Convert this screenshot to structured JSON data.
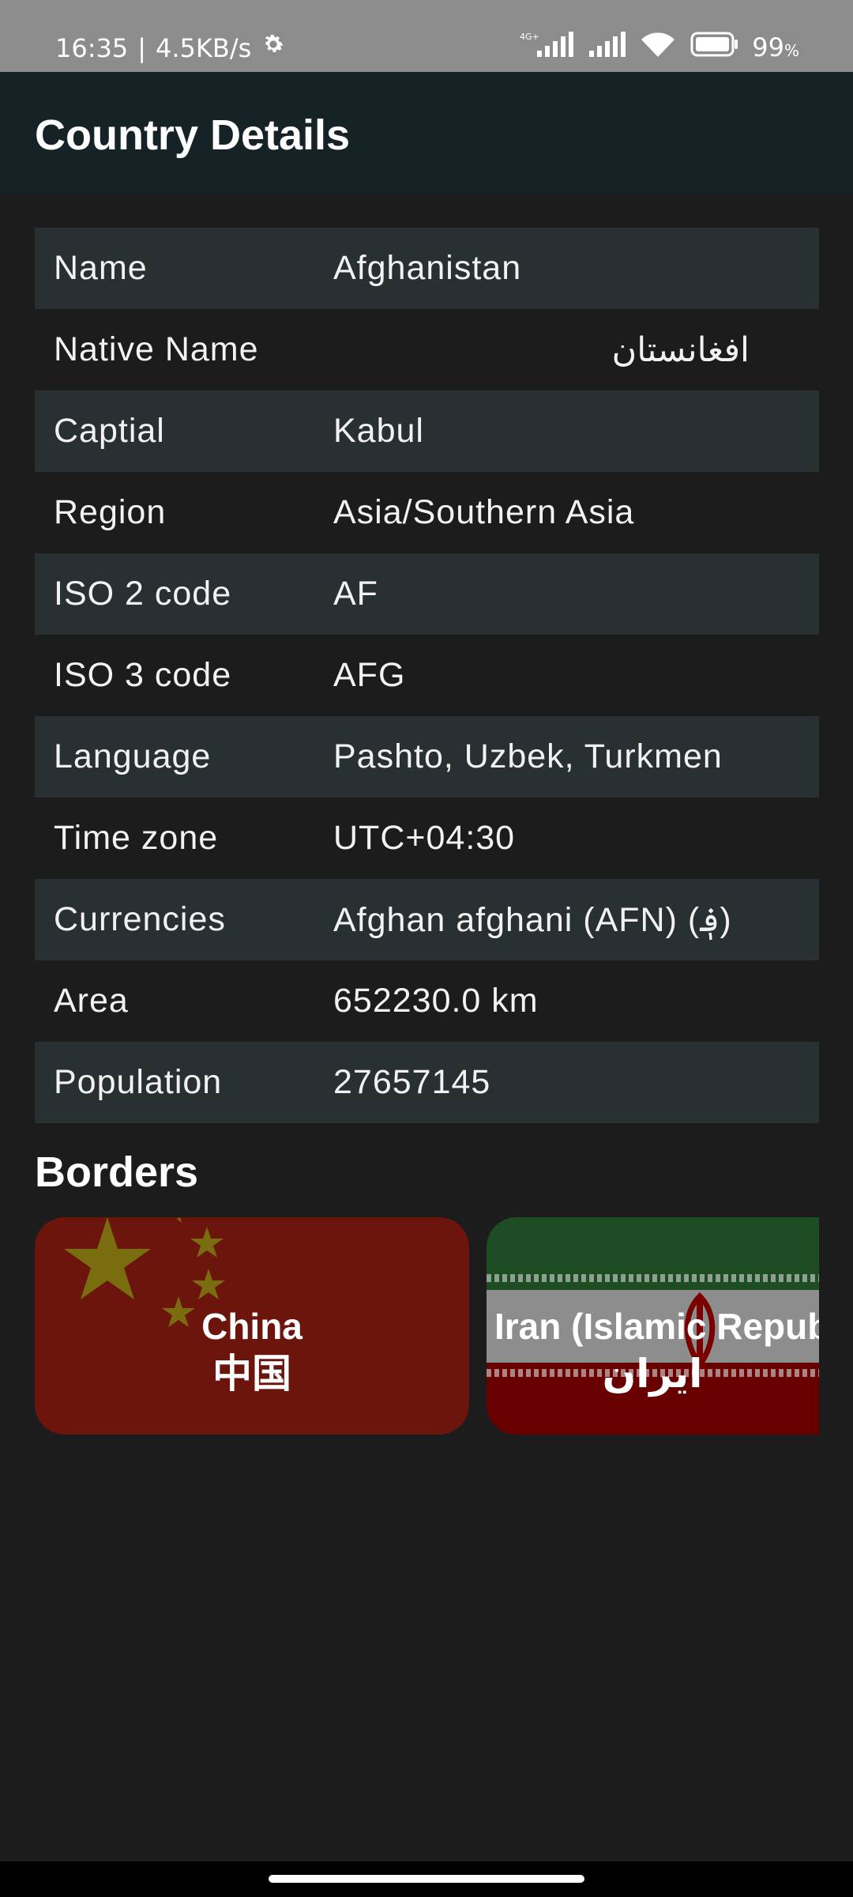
{
  "status_bar": {
    "time": "16:35",
    "speed": "4.5KB/s",
    "network_label": "4G+",
    "battery_percent": "99",
    "battery_unit": "%",
    "icons": [
      "gear-icon",
      "signal-icon",
      "signal-icon",
      "wifi-icon",
      "battery-icon"
    ]
  },
  "app_bar": {
    "title": "Country Details"
  },
  "details": {
    "rows": [
      {
        "label": "Name",
        "value": "Afghanistan"
      },
      {
        "label": "Native Name",
        "value": "افغانستان"
      },
      {
        "label": "Captial",
        "value": "Kabul"
      },
      {
        "label": "Region",
        "value": "Asia/Southern Asia"
      },
      {
        "label": "ISO 2 code",
        "value": "AF"
      },
      {
        "label": "ISO 3 code",
        "value": "AFG"
      },
      {
        "label": "Language",
        "value": "Pashto, Uzbek, Turkmen"
      },
      {
        "label": "Time zone",
        "value": "UTC+04:30"
      },
      {
        "label": "Currencies",
        "value": "Afghan afghani (AFN) (؋)"
      },
      {
        "label": "Area",
        "value": "652230.0 km"
      },
      {
        "label": "Population",
        "value": "27657145"
      }
    ]
  },
  "borders": {
    "title": "Borders",
    "cards": [
      {
        "name": "China",
        "native_name": "中国"
      },
      {
        "name": "Iran (Islamic Republ",
        "native_name": "ایران"
      }
    ]
  },
  "colors": {
    "background": "#1c1c1c",
    "app_bar": "#152226",
    "shaded_row": "#293032",
    "status_bar": "#8c8c8c"
  }
}
